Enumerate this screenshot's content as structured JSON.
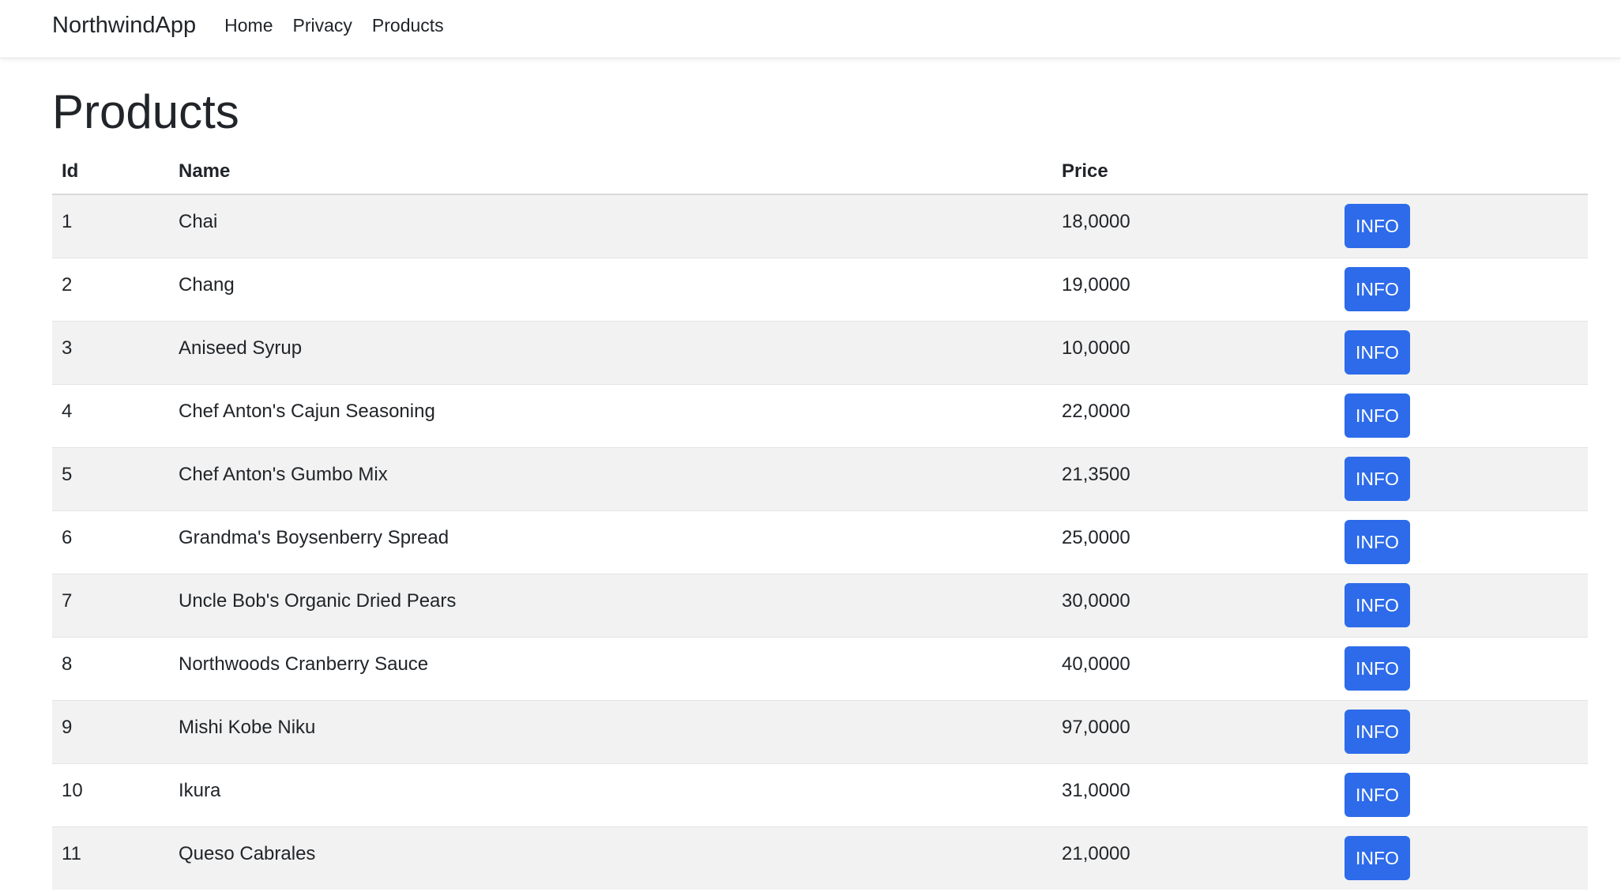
{
  "navbar": {
    "brand": "NorthwindApp",
    "links": [
      "Home",
      "Privacy",
      "Products"
    ]
  },
  "page": {
    "title": "Products"
  },
  "table": {
    "headers": {
      "id": "Id",
      "name": "Name",
      "price": "Price",
      "action": ""
    },
    "rows": [
      {
        "id": "1",
        "name": "Chai",
        "price": "18,0000",
        "action": "INFO"
      },
      {
        "id": "2",
        "name": "Chang",
        "price": "19,0000",
        "action": "INFO"
      },
      {
        "id": "3",
        "name": "Aniseed Syrup",
        "price": "10,0000",
        "action": "INFO"
      },
      {
        "id": "4",
        "name": "Chef Anton's Cajun Seasoning",
        "price": "22,0000",
        "action": "INFO"
      },
      {
        "id": "5",
        "name": "Chef Anton's Gumbo Mix",
        "price": "21,3500",
        "action": "INFO"
      },
      {
        "id": "6",
        "name": "Grandma's Boysenberry Spread",
        "price": "25,0000",
        "action": "INFO"
      },
      {
        "id": "7",
        "name": "Uncle Bob's Organic Dried Pears",
        "price": "30,0000",
        "action": "INFO"
      },
      {
        "id": "8",
        "name": "Northwoods Cranberry Sauce",
        "price": "40,0000",
        "action": "INFO"
      },
      {
        "id": "9",
        "name": "Mishi Kobe Niku",
        "price": "97,0000",
        "action": "INFO"
      },
      {
        "id": "10",
        "name": "Ikura",
        "price": "31,0000",
        "action": "INFO"
      },
      {
        "id": "11",
        "name": "Queso Cabrales",
        "price": "21,0000",
        "action": "INFO"
      }
    ]
  },
  "colors": {
    "button_bg": "#2d6bea",
    "button_text": "#ffffff",
    "row_stripe": "#f2f2f2",
    "text": "#212529"
  }
}
